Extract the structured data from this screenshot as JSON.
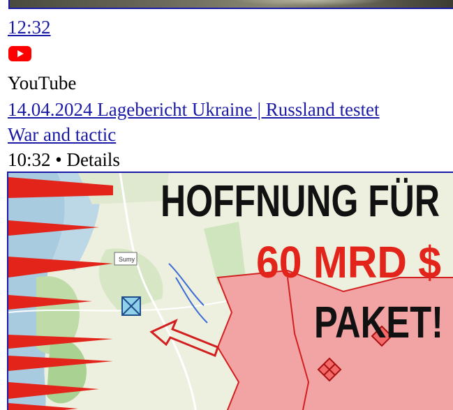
{
  "top_video": {
    "duration": "12:32",
    "source_icon": "youtube-icon",
    "source": "YouTube"
  },
  "video": {
    "title": "14.04.2024 Lagebericht Ukraine | Russland testet",
    "channel": "War and tactic",
    "meta": "10:32 • Details",
    "thumbnail": {
      "headline_1": "HOFFNUNG FÜR",
      "headline_2": "60 MRD $",
      "headline_3": "PAKET!",
      "map_label": "Sumy"
    }
  },
  "colors": {
    "link": "#1a1aa6",
    "youtube_red": "#ff0000",
    "headline_red": "#e3241b",
    "zone_fill": "#f2a3a3"
  }
}
